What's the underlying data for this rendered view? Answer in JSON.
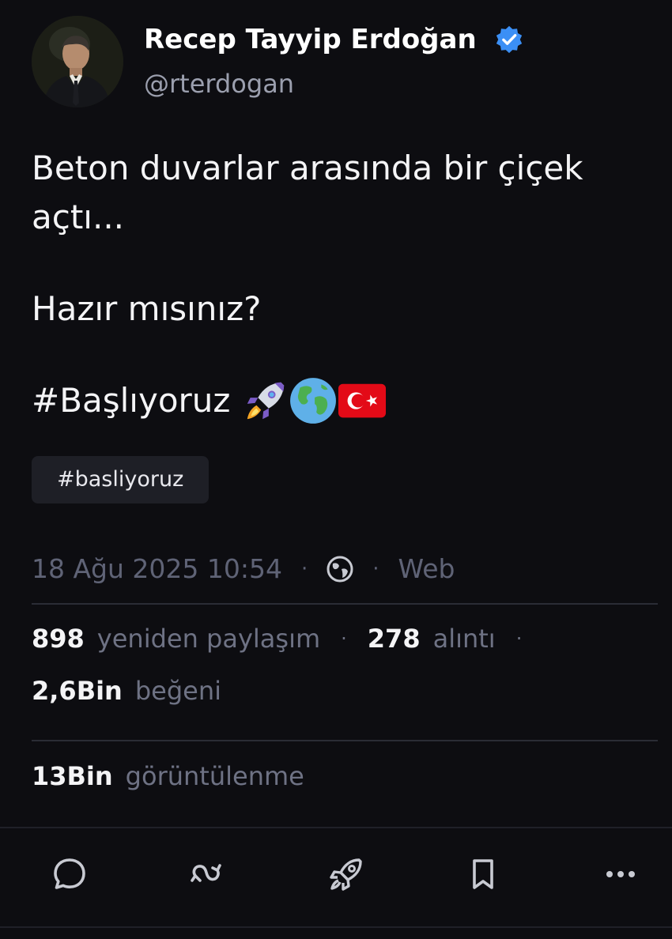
{
  "author": {
    "name": "Recep Tayyip Erdoğan",
    "handle": "@rterdogan",
    "verified": true,
    "verified_color": "#3b8ff5"
  },
  "post": {
    "paragraphs": [
      "Beton duvarlar arasında bir çiçek açtı...",
      "Hazır mısınız?"
    ],
    "hashtag_text": "#Başlıyoruz",
    "emojis": [
      "rocket-emoji",
      "globe-emoji",
      "turkey-flag-emoji"
    ],
    "tag_chip": "#basliyoruz"
  },
  "meta": {
    "timestamp": "18 Ağu 2025 10:54",
    "separator": "·",
    "visibility_icon": "globe-icon",
    "client": "Web"
  },
  "stats": {
    "reposts_count": "898",
    "reposts_label": "yeniden paylaşım",
    "quotes_count": "278",
    "quotes_label": "alıntı",
    "likes_count": "2,6Bin",
    "likes_label": "beğeni",
    "views_count": "13Bin",
    "views_label": "görüntülenme"
  },
  "actions": [
    "reply-icon",
    "repost-icon",
    "boost-rocket-icon",
    "bookmark-icon",
    "more-icon"
  ],
  "colors": {
    "background": "#0d0d11",
    "text": "#f4f4f6",
    "muted": "#6e7284",
    "chip_bg": "#1e1f26"
  }
}
